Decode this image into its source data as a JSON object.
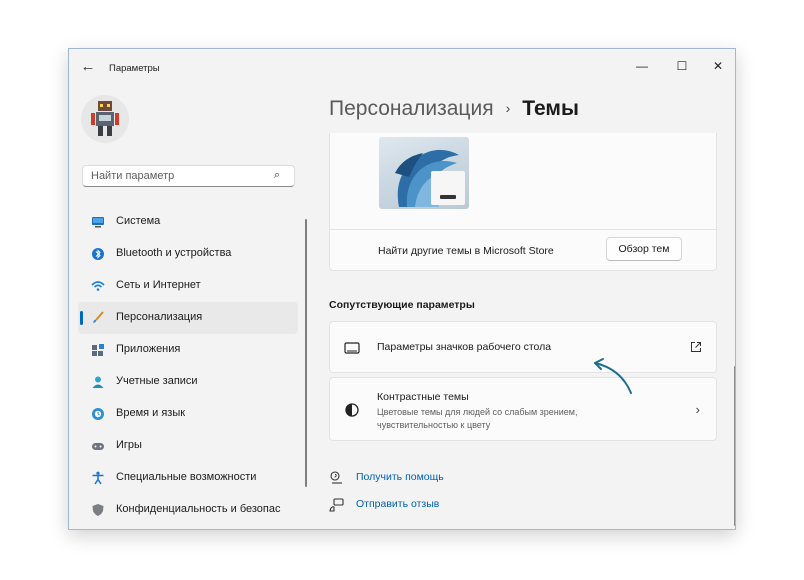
{
  "window": {
    "app_title": "Параметры"
  },
  "search": {
    "placeholder": "Найти параметр"
  },
  "sidebar": {
    "items": [
      {
        "label": "Система",
        "icon": "monitor-icon"
      },
      {
        "label": "Bluetooth и устройства",
        "icon": "bluetooth-icon"
      },
      {
        "label": "Сеть и Интернет",
        "icon": "wifi-icon"
      },
      {
        "label": "Персонализация",
        "icon": "brush-icon",
        "active": true
      },
      {
        "label": "Приложения",
        "icon": "apps-icon"
      },
      {
        "label": "Учетные записи",
        "icon": "person-icon"
      },
      {
        "label": "Время и язык",
        "icon": "globe-clock-icon"
      },
      {
        "label": "Игры",
        "icon": "gamepad-icon"
      },
      {
        "label": "Специальные возможности",
        "icon": "accessibility-icon"
      },
      {
        "label": "Конфиденциальность и безопас",
        "icon": "shield-icon"
      }
    ]
  },
  "header": {
    "parent": "Персонализация",
    "separator": "›",
    "current": "Темы"
  },
  "themes": {
    "store_text": "Найти другие темы в Microsoft Store",
    "browse_button": "Обзор тем"
  },
  "related": {
    "heading": "Сопутствующие параметры",
    "desktop_icons": {
      "title": "Параметры значков рабочего стола"
    },
    "contrast": {
      "title": "Контрастные темы",
      "subtitle": "Цветовые темы для людей со слабым зрением, чувствительностью к цвету"
    }
  },
  "links": {
    "help": "Получить помощь",
    "feedback": "Отправить отзыв"
  },
  "colors": {
    "accent": "#0067c0",
    "link": "#005fb8",
    "window_bg": "#f3f3f3",
    "card_bg": "#fbfbfb"
  }
}
